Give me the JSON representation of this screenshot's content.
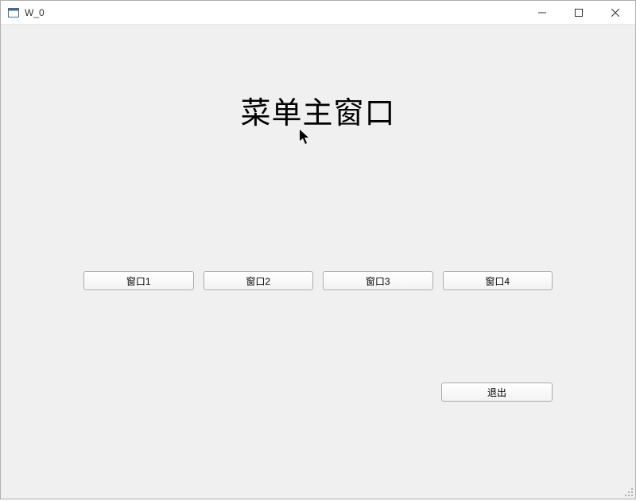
{
  "window": {
    "title": "W_0"
  },
  "main": {
    "heading": "菜单主窗口"
  },
  "buttons": {
    "window1": "窗口1",
    "window2": "窗口2",
    "window3": "窗口3",
    "window4": "窗口4",
    "exit": "退出"
  }
}
